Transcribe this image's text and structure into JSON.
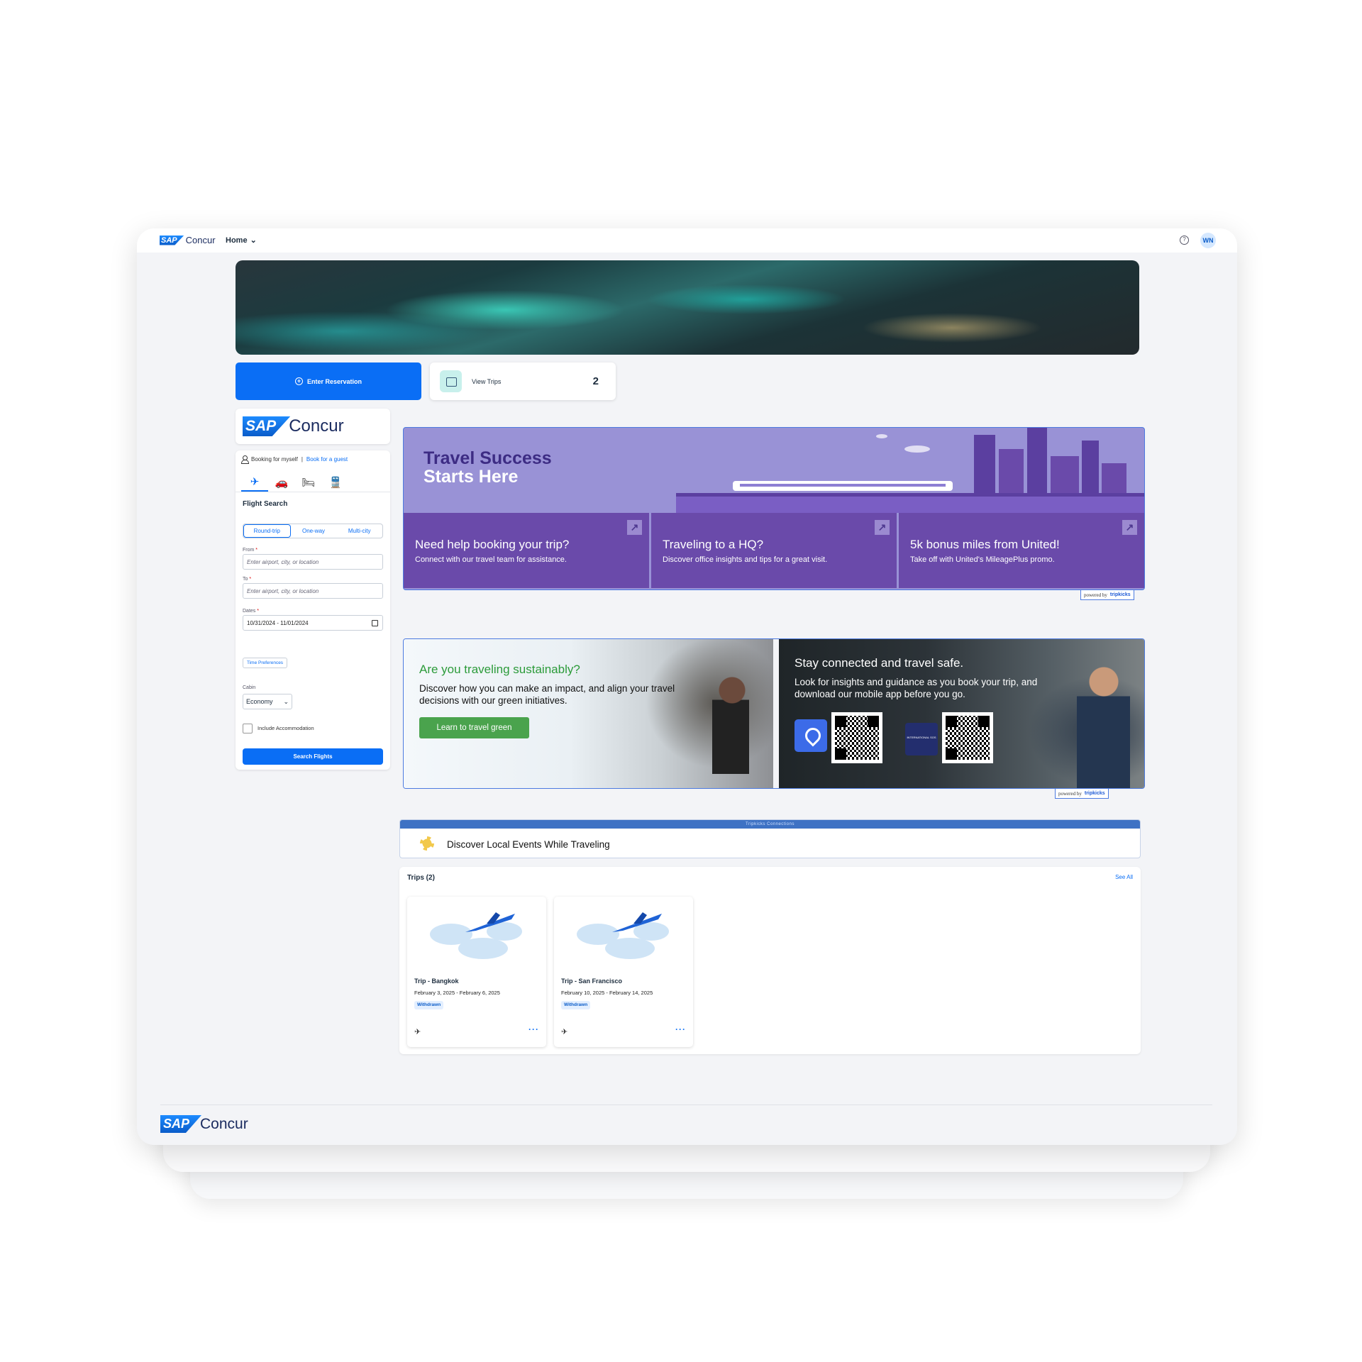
{
  "app": {
    "logo_sap": "SAP",
    "logo_concur": "Concur",
    "nav_menu": "Home",
    "user_initials": "WN",
    "help_symbol": "?"
  },
  "actions": {
    "enter_reservation": "Enter Reservation",
    "view_trips": "View Trips",
    "trips_count": "2"
  },
  "booking": {
    "booking_for": "Booking for myself",
    "separator": "|",
    "guest_link": "Book for a guest",
    "modes": [
      {
        "icon": "flight-train-icon",
        "glyph": "✈"
      },
      {
        "icon": "car-icon",
        "glyph": "🚗"
      },
      {
        "icon": "hotel-icon",
        "glyph": "🛏"
      },
      {
        "icon": "rail-icon",
        "glyph": "🚆"
      }
    ],
    "section_title": "Flight Search",
    "trip_types": [
      "Round-trip",
      "One-way",
      "Multi-city"
    ],
    "from_label": "From",
    "from_placeholder": "Enter airport, city, or location",
    "to_label": "To",
    "to_placeholder": "Enter airport, city, or location",
    "dates_label": "Dates",
    "dates_value": "10/31/2024 - 11/01/2024",
    "time_preferences": "Time Preferences",
    "cabin_label": "Cabin",
    "cabin_value": "Economy",
    "include_accommodation": "Include Accommodation",
    "search_button": "Search Flights",
    "required_mark": "*"
  },
  "promo_travel_success": {
    "title_line1": "Travel Success",
    "title_line2": "Starts Here",
    "cards": [
      {
        "title": "Need help booking your trip?",
        "subtitle": "Connect with our travel team for assistance."
      },
      {
        "title": "Traveling to a HQ?",
        "subtitle": "Discover office insights and tips for a great visit."
      },
      {
        "title": "5k bonus miles from United!",
        "subtitle": "Take off with United's MileagePlus promo."
      }
    ],
    "powered_by": "powered by",
    "brand": "tripkicks"
  },
  "promo_sustainability": {
    "left_title": "Are you traveling sustainably?",
    "left_text": "Discover how you can make an impact, and align your travel decisions with our green initiatives.",
    "left_button": "Learn to travel green",
    "right_title": "Stay connected and travel safe.",
    "right_text": "Look for insights and guidance as you book your trip, and download our mobile app before you go.",
    "sos_label": "INTERNATIONAL SOS",
    "powered_by": "powered by",
    "brand": "tripkicks"
  },
  "events": {
    "banner": "Tripkicks Connections",
    "label": "Discover Local Events While Traveling"
  },
  "trips": {
    "heading": "Trips (2)",
    "see_all": "See All",
    "items": [
      {
        "name": "Trip - Bangkok",
        "dates": "February 3, 2025 - February 6, 2025",
        "status": "Withdrawn"
      },
      {
        "name": "Trip - San Francisco",
        "dates": "February 10, 2025 - February 14, 2025",
        "status": "Withdrawn"
      }
    ],
    "more_glyph": "···",
    "plane_glyph": "✈"
  },
  "colors": {
    "primary": "#0a6ef5",
    "promo_purple": "#6a4aaa",
    "promo_lavender": "#9992d6",
    "green": "#4aa34d"
  }
}
